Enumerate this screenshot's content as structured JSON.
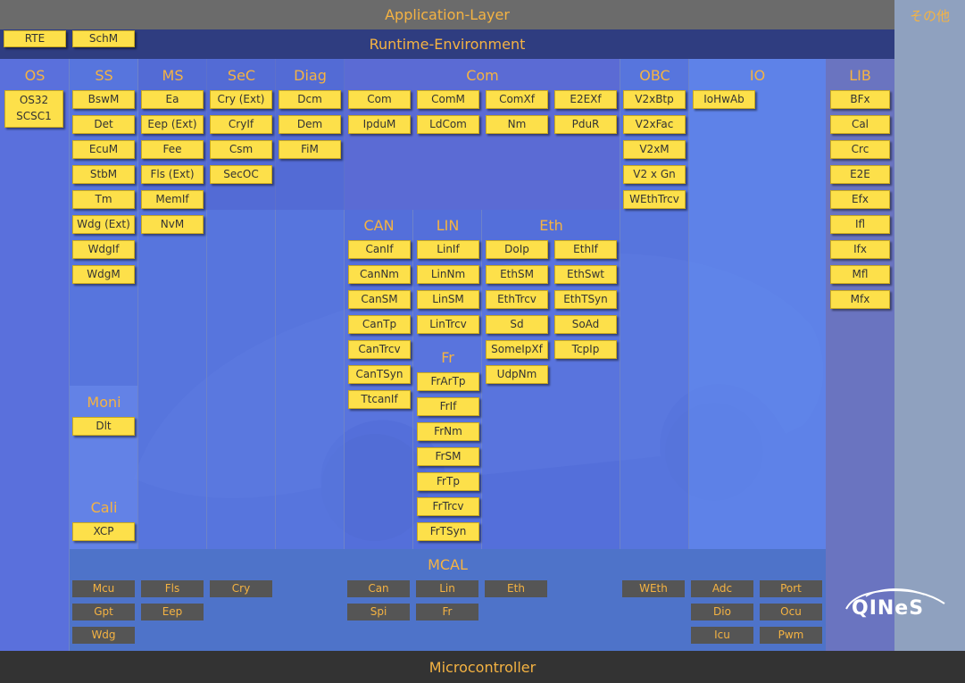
{
  "app_layer": "Application-Layer",
  "rte_label": "Runtime-Environment",
  "rte_modules": [
    "RTE",
    "SchM"
  ],
  "microcontroller": "Microcontroller",
  "other": "その他",
  "mcal_title": "MCAL",
  "colors": {
    "module_bg": "#fde04a",
    "label": "#f5b342",
    "mcal_module_bg": "#555555",
    "panel": "#5a6fd6"
  },
  "sections": {
    "os": {
      "title": "OS",
      "modules": [
        "OS32 SCSC1"
      ]
    },
    "ss": {
      "title": "SS",
      "modules": [
        "BswM",
        "Det",
        "EcuM",
        "StbM",
        "Tm",
        "Wdg (Ext)",
        "WdgIf",
        "WdgM"
      ]
    },
    "moni": {
      "title": "Moni",
      "modules": [
        "Dlt"
      ]
    },
    "cali": {
      "title": "Cali",
      "modules": [
        "XCP"
      ]
    },
    "ms": {
      "title": "MS",
      "modules": [
        "Ea",
        "Eep (Ext)",
        "Fee",
        "Fls (Ext)",
        "MemIf",
        "NvM"
      ]
    },
    "sec": {
      "title": "SeC",
      "modules": [
        "Cry (Ext)",
        "CryIf",
        "Csm",
        "SecOC"
      ]
    },
    "diag": {
      "title": "Diag",
      "modules": [
        "Dcm",
        "Dem",
        "FiM"
      ]
    },
    "com": {
      "title": "Com",
      "modules": [
        "Com",
        "ComM",
        "ComXf",
        "E2EXf",
        "IpduM",
        "LdCom",
        "Nm",
        "PduR"
      ]
    },
    "obc": {
      "title": "OBC",
      "modules": [
        "V2xBtp",
        "V2xFac",
        "V2xM",
        "V2 x Gn",
        "WEthTrcv"
      ]
    },
    "io": {
      "title": "IO",
      "modules": [
        "IoHwAb"
      ]
    },
    "lib": {
      "title": "LIB",
      "modules": [
        "BFx",
        "Cal",
        "Crc",
        "E2E",
        "Efx",
        "Ifl",
        "Ifx",
        "Mfl",
        "Mfx"
      ]
    },
    "can": {
      "title": "CAN",
      "modules": [
        "CanIf",
        "CanNm",
        "CanSM",
        "CanTp",
        "CanTrcv",
        "CanTSyn",
        "TtcanIf"
      ]
    },
    "lin": {
      "title": "LIN",
      "modules": [
        "LinIf",
        "LinNm",
        "LinSM",
        "LinTrcv"
      ]
    },
    "fr": {
      "title": "Fr",
      "modules": [
        "FrArTp",
        "FrIf",
        "FrNm",
        "FrSM",
        "FrTp",
        "FrTrcv",
        "FrTSyn"
      ]
    },
    "eth": {
      "title": "Eth",
      "modules": [
        "DoIp",
        "EthIf",
        "EthSM",
        "EthSwt",
        "EthTrcv",
        "EthTSyn",
        "Sd",
        "SoAd",
        "SomeIpXf",
        "TcpIp",
        "UdpNm"
      ]
    }
  },
  "mcal_modules": [
    "Mcu",
    "Fls",
    "Cry",
    "Can",
    "Lin",
    "Eth",
    "WEth",
    "Adc",
    "Port",
    "Gpt",
    "Eep",
    "Spi",
    "Fr",
    "Dio",
    "Ocu",
    "Wdg",
    "Icu",
    "Pwm"
  ],
  "logo": "QINeS"
}
